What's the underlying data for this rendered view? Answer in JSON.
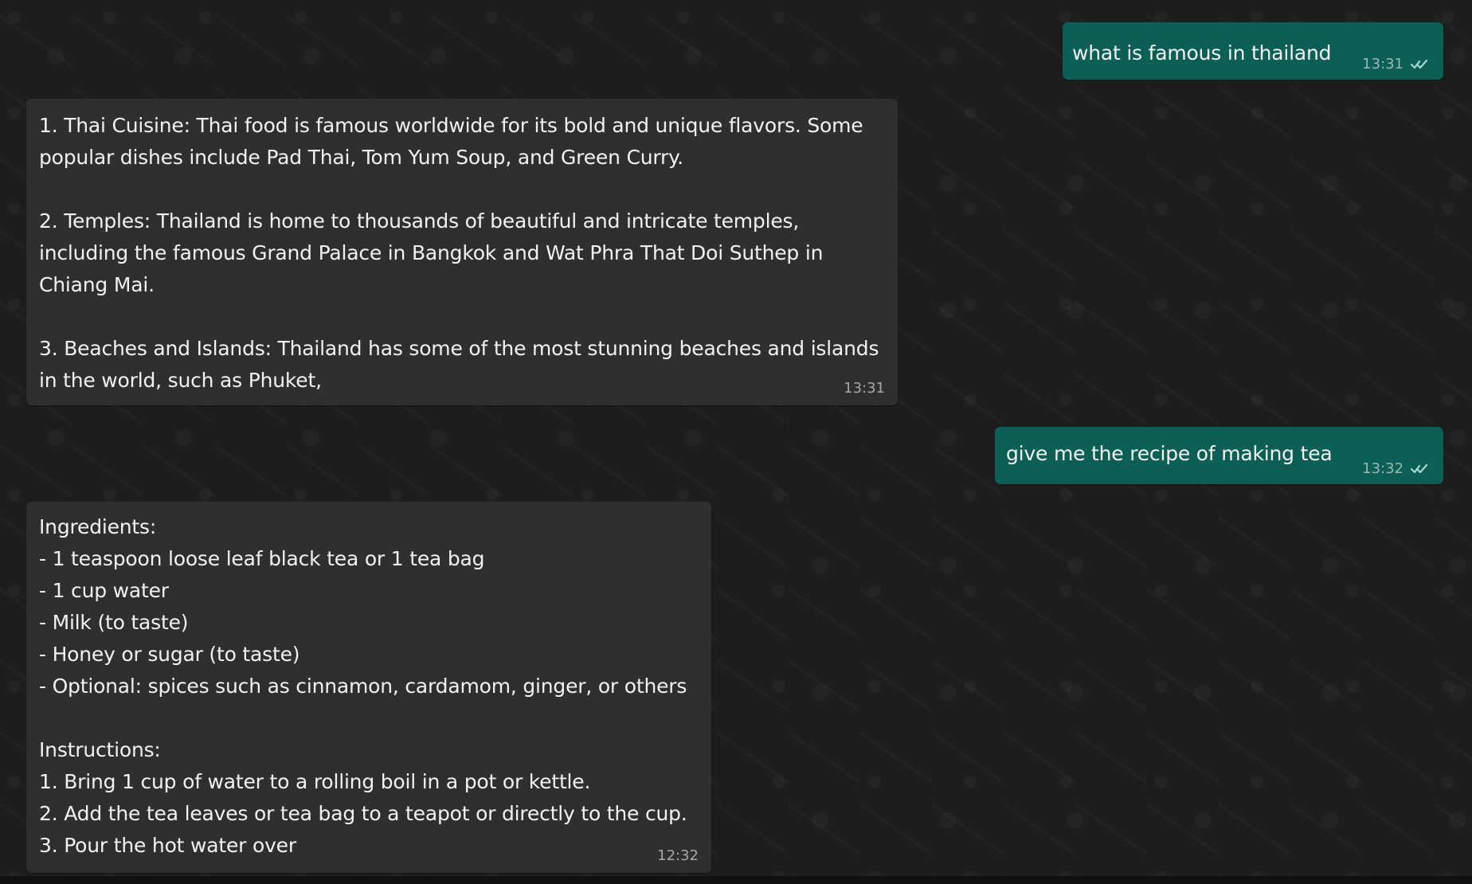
{
  "messages": [
    {
      "direction": "outgoing",
      "text": "what is famous in thailand",
      "time": "13:31",
      "status_icon": "double-check-icon"
    },
    {
      "direction": "incoming",
      "text": "1. Thai Cuisine: Thai food is famous worldwide for its bold and unique flavors. Some\npopular dishes include Pad Thai, Tom Yum Soup, and Green Curry.\n\n2. Temples: Thailand is home to thousands of beautiful and intricate temples,\nincluding the famous Grand Palace in Bangkok and Wat Phra That Doi Suthep in\nChiang Mai.\n\n3. Beaches and Islands: Thailand has some of the most stunning beaches and islands\nin the world, such as Phuket,",
      "time": "13:31"
    },
    {
      "direction": "outgoing",
      "text": "give me the recipe of making tea",
      "time": "13:32",
      "status_icon": "double-check-icon"
    },
    {
      "direction": "incoming",
      "text": "Ingredients:\n- 1 teaspoon loose leaf black tea or 1 tea bag\n- 1 cup water\n- Milk (to taste)\n- Honey or sugar (to taste)\n- Optional: spices such as cinnamon, cardamom, ginger, or others\n\nInstructions:\n1. Bring 1 cup of water to a rolling boil in a pot or kettle.\n2. Add the tea leaves or tea bag to a teapot or directly to the cup.\n3. Pour the hot water over",
      "time": "12:32"
    }
  ],
  "colors": {
    "chat_background": "#1d1d1d",
    "incoming_bubble": "#2f2f2f",
    "outgoing_bubble": "#0b5f54",
    "text": "#f2f2f2",
    "meta_text": "#b8b8b8"
  }
}
